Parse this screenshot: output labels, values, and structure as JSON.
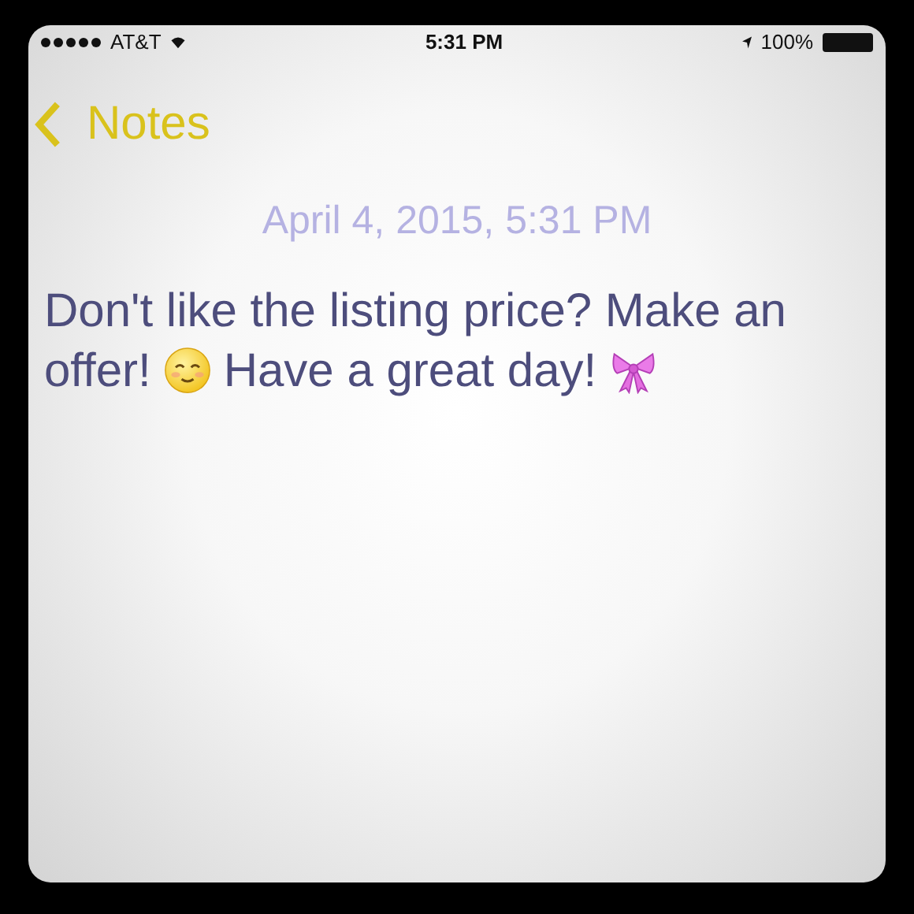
{
  "status_bar": {
    "carrier": "AT&T",
    "time": "5:31 PM",
    "battery": "100%"
  },
  "nav": {
    "back_label": "Notes"
  },
  "note": {
    "date": "April 4, 2015, 5:31 PM",
    "lines": [
      [
        {
          "kind": "text",
          "text": "Don't like the listing price? Make an"
        }
      ],
      [
        {
          "kind": "text",
          "text": "offer!"
        },
        {
          "kind": "smiley"
        },
        {
          "kind": "text",
          "text": "Have a great day!"
        },
        {
          "kind": "bow"
        }
      ]
    ]
  }
}
